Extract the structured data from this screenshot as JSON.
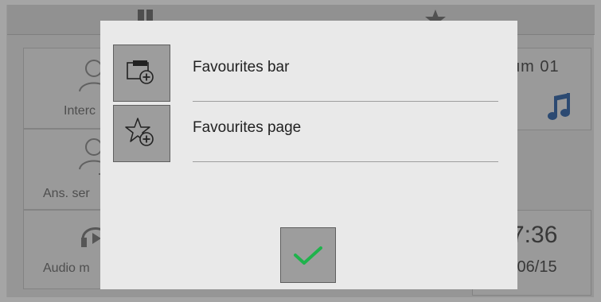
{
  "background": {
    "tiles": [
      {
        "label": "Interc"
      },
      {
        "label": "Ans. ser"
      },
      {
        "label": "Audio m"
      }
    ],
    "room_label": "um 01",
    "time": "7:36",
    "date": "/06/15",
    "icons": {
      "top_left": "grid-icon",
      "top_right": "star-icon",
      "music": "music-note-icon",
      "intercom": "person-icon",
      "answering": "person-arrow-icon",
      "audio": "headphones-play-icon"
    },
    "colors": {
      "music_icon": "#2f62a8"
    }
  },
  "dialog": {
    "options": [
      {
        "label": "Favourites bar",
        "icon": "favourites-bar-add-icon"
      },
      {
        "label": "Favourites page",
        "icon": "star-add-icon"
      }
    ],
    "confirm": {
      "icon": "checkmark-icon",
      "color": "#1fb34c"
    }
  }
}
